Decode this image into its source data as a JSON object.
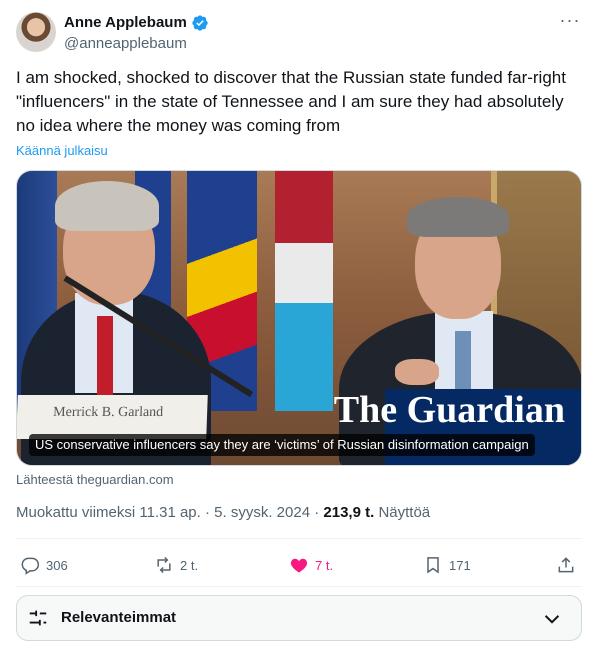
{
  "author": {
    "display_name": "Anne Applebaum",
    "handle": "@anneapplebaum"
  },
  "tweet": {
    "text": "I am shocked, shocked to discover that the Russian state funded far-right \"influencers\" in the state of Tennessee and I am sure they had absolutely no idea where the money was coming from",
    "translate_link": "Käännä julkaisu"
  },
  "card": {
    "headline": "US conservative influencers say they are ‘victims’ of Russian disinformation campaign",
    "image_text_nameplate": "Merrick B. Garland",
    "image_text_logo": "The Guardian",
    "source": "Lähteestä theguardian.com"
  },
  "meta": {
    "edited": "Muokattu viimeksi 11.31 ap.",
    "date": "5. syysk. 2024",
    "views_count": "213,9 t.",
    "views_label": "Näyttöä"
  },
  "actions": {
    "replies": "306",
    "reposts": "2 t.",
    "likes": "7 t.",
    "bookmarks": "171"
  },
  "replies_sort": {
    "label": "Relevanteimmat"
  },
  "colors": {
    "accent": "#1d9bf0",
    "like": "#f91880",
    "guardian_blue": "#052962"
  }
}
